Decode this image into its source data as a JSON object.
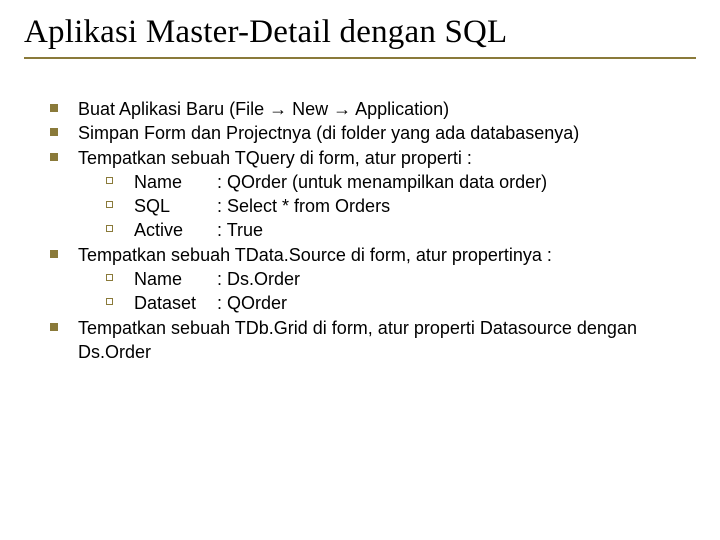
{
  "title": "Aplikasi Master-Detail dengan SQL",
  "bullets": [
    {
      "text": "Buat Aplikasi Baru (File → New → Application)"
    },
    {
      "text": "Simpan Form dan Projectnya (di folder yang ada databasenya)"
    },
    {
      "text": "Tempatkan sebuah TQuery di form, atur properti :",
      "sub": [
        {
          "label": "Name",
          "value": ": QOrder (untuk menampilkan data order)"
        },
        {
          "label": "SQL",
          "value": ": Select * from Orders"
        },
        {
          "label": "Active",
          "value": ": True"
        }
      ]
    },
    {
      "text": "Tempatkan sebuah TData.Source di form, atur propertinya :",
      "sub": [
        {
          "label": "Name",
          "value": ": Ds.Order"
        },
        {
          "label": "Dataset",
          "value": ": QOrder"
        }
      ]
    },
    {
      "text": "Tempatkan sebuah TDb.Grid di form, atur properti Datasource dengan Ds.Order"
    }
  ]
}
